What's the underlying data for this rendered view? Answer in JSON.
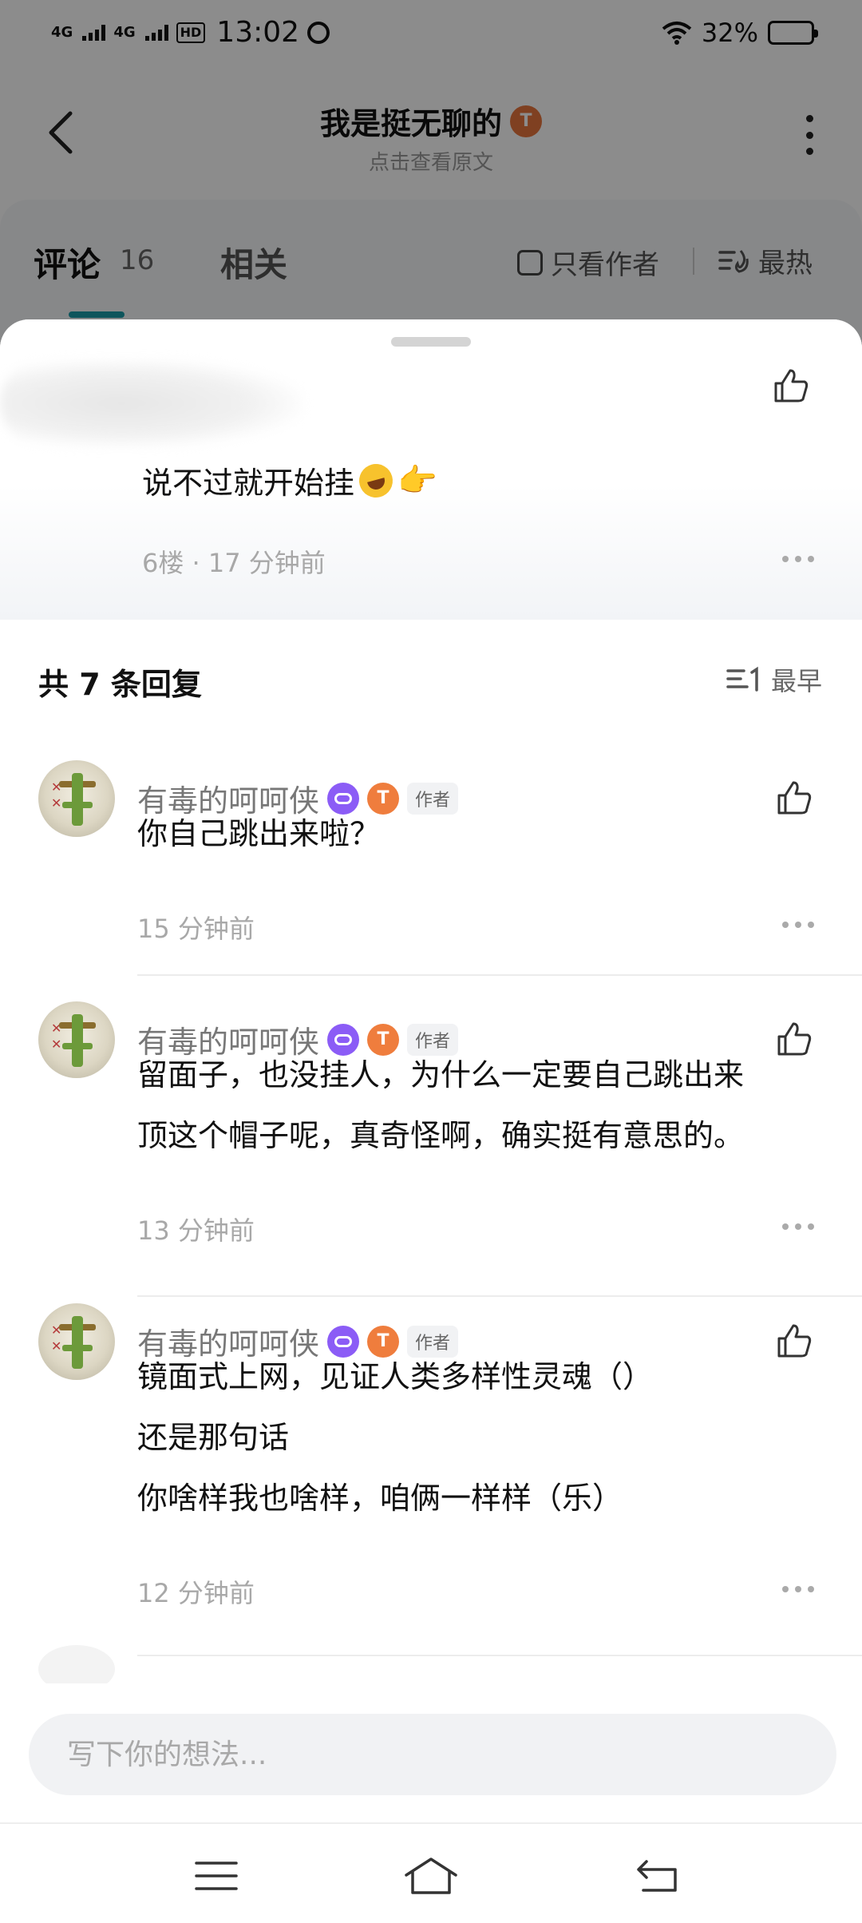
{
  "status_bar": {
    "network1": "4G",
    "network2": "4G",
    "hd": "HD",
    "time": "13:02",
    "battery": "32%",
    "battery_level": 0.32
  },
  "header": {
    "title": "我是挺无聊的",
    "subtitle": "点击查看原文",
    "level_badge": "T"
  },
  "tabs": {
    "comments_label": "评论",
    "comments_count": "16",
    "related_label": "相关",
    "only_author_label": "只看作者",
    "sort_label": "最热"
  },
  "main_comment": {
    "text": "说不过就开始挂",
    "meta": "6楼 · 17 分钟前"
  },
  "replies_header": {
    "title": "共 7 条回复",
    "sort_label": "最早"
  },
  "replies": [
    {
      "name": "有毒的呵呵侠",
      "badge_t": "T",
      "author_tag": "作者",
      "lines": [
        "你自己跳出来啦？"
      ],
      "time": "15 分钟前"
    },
    {
      "name": "有毒的呵呵侠",
      "badge_t": "T",
      "author_tag": "作者",
      "lines": [
        "留面子，也没挂人，为什么一定要自己跳出来",
        "顶这个帽子呢，真奇怪啊，确实挺有意思的。"
      ],
      "time": "13 分钟前"
    },
    {
      "name": "有毒的呵呵侠",
      "badge_t": "T",
      "author_tag": "作者",
      "lines": [
        "镜面式上网，见证人类多样性灵魂（）",
        "还是那句话",
        "你啥样我也啥样，咱俩一样样（乐）"
      ],
      "time": "12 分钟前"
    }
  ],
  "input": {
    "placeholder": "写下你的想法..."
  },
  "colors": {
    "accent": "#1b9ba8",
    "level_badge": "#ef7d3d",
    "game_badge": "#8b5cf6"
  }
}
